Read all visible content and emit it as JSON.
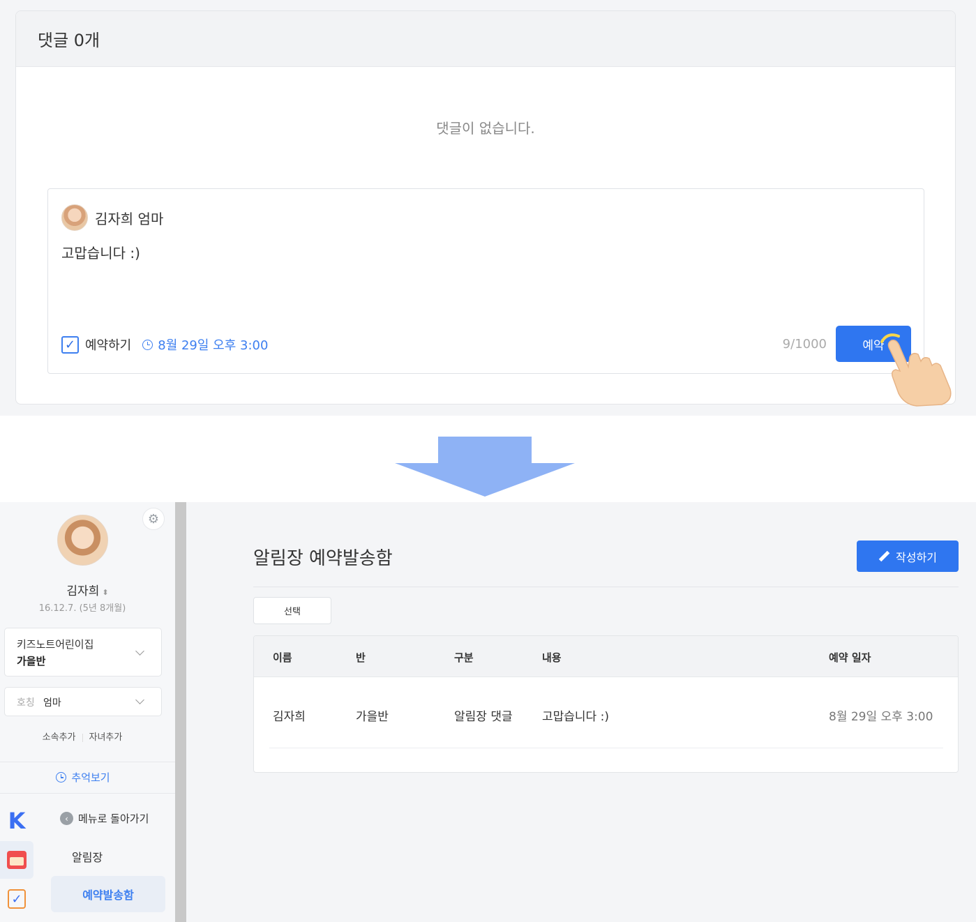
{
  "comments": {
    "header": "댓글 0개",
    "empty_message": "댓글이 없습니다.",
    "composer": {
      "user_name": "김자희 엄마",
      "text": "고맙습니다 :)",
      "reserve_label": "예약하기",
      "reserve_checked": true,
      "reserve_time": "8월 29일 오후 3:00",
      "counter": "9/1000",
      "submit_label": "예약"
    }
  },
  "sidebar": {
    "child_name": "김자희",
    "child_birth": "16.12.7. (5년 8개월)",
    "org_name": "키즈노트어린이집",
    "org_class": "가을반",
    "title_label": "호칭",
    "title_value": "엄마",
    "add_org": "소속추가",
    "add_child": "자녀추가",
    "memory": "추억보기",
    "back_menu": "메뉴로 돌아가기",
    "menu_notice": "알림장",
    "menu_reserved": "예약발송함"
  },
  "main": {
    "page_title": "알림장 예약발송함",
    "write_label": "작성하기",
    "select_label": "선택",
    "columns": [
      "이름",
      "반",
      "구분",
      "내용",
      "예약 일자"
    ],
    "rows": [
      [
        "김자희",
        "가을반",
        "알림장 댓글",
        "고맙습니다 :)",
        "8월 29일 오후 3:00"
      ]
    ]
  },
  "colors": {
    "accent": "#2f76f0",
    "arrow": "#8eb2f5",
    "link": "#3d7ff0"
  },
  "icons": [
    "clock-icon",
    "check-icon",
    "gear-icon",
    "chevron-down-icon",
    "back-icon",
    "pencil-icon",
    "kidsnote-logo-icon",
    "notice-icon",
    "checklist-icon",
    "pointer-hand-icon",
    "arrow-down-icon"
  ]
}
